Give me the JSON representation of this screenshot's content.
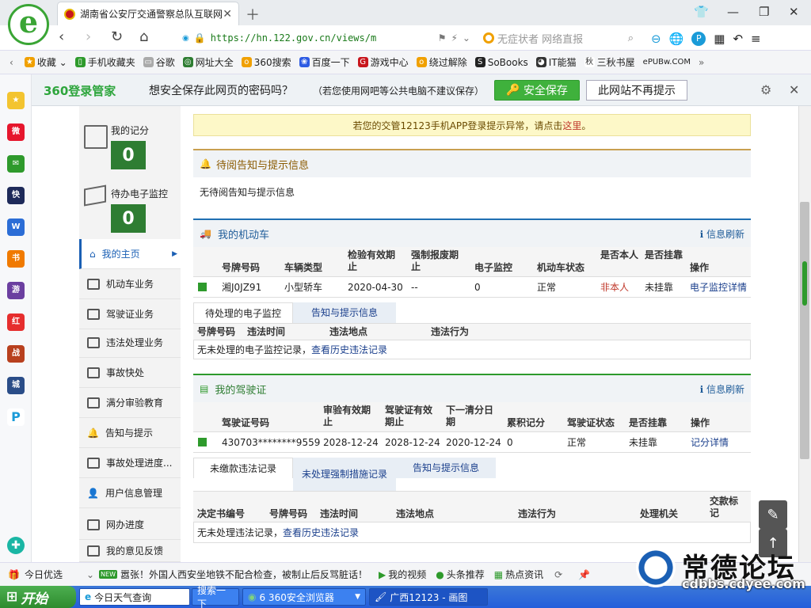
{
  "browser": {
    "tab_title": "湖南省公安厅交通警察总队互联网",
    "url": "https://hn.122.gov.cn/views/m",
    "search_placeholder": "无症状者 网络直报",
    "bookmarks": [
      "收藏",
      "手机收藏夹",
      "谷歌",
      "网址大全",
      "360搜索",
      "百度一下",
      "游戏中心",
      "绕过解除",
      "SoBooks",
      "IT能猫",
      "三秋书屋",
      "ePUBw.COM"
    ]
  },
  "password_bar": {
    "brand": "360登录管家",
    "question": "想安全保存此网页的密码吗？",
    "note": "（若您使用网吧等公共电脑不建议保存）",
    "save_label": "安全保存",
    "never_label": "此网站不再提示"
  },
  "sidebar_icons": [
    "favorites",
    "weibo",
    "mail",
    "tiantian",
    "word",
    "game1",
    "game2",
    "xiaohong",
    "game3",
    "game4",
    "p",
    "plus"
  ],
  "page_nav": {
    "score_label": "我的记分",
    "score_value": "0",
    "monitor_label": "待办电子监控",
    "monitor_value": "0",
    "items": [
      "我的主页",
      "机动车业务",
      "驾驶证业务",
      "违法处理业务",
      "事故快处",
      "满分审验教育",
      "告知与提示",
      "事故处理进度...",
      "用户信息管理",
      "网办进度",
      "我的意见反馈"
    ]
  },
  "notice": {
    "text": "若您的交管12123手机APP登录提示异常，请点击",
    "link": "这里",
    "tail": "。"
  },
  "pending_notice": {
    "title": "待阅告知与提示信息",
    "content": "无待阅告知与提示信息"
  },
  "vehicle": {
    "title": "我的机动车",
    "refresh": "信息刷新",
    "headers": [
      "号牌号码",
      "车辆类型",
      "检验有效期止",
      "强制报废期止",
      "电子监控",
      "机动车状态",
      "是否本人",
      "是否挂靠",
      "操作"
    ],
    "row": {
      "plate": "湘J0JZ91",
      "type": "小型轿车",
      "inspect": "2020-04-30",
      "scrap": "--",
      "monitor": "0",
      "status": "正常",
      "owner": "非本人",
      "affiliated": "未挂靠",
      "action": "电子监控详情"
    },
    "tabs": [
      "待处理的电子监控",
      "告知与提示信息"
    ],
    "sub_headers": [
      "号牌号码",
      "违法时间",
      "违法地点",
      "违法行为"
    ],
    "empty": "无未处理的电子监控记录，",
    "history_link": "查看历史违法记录"
  },
  "license": {
    "title": "我的驾驶证",
    "refresh": "信息刷新",
    "headers": [
      "驾驶证号码",
      "审验有效期止",
      "驾驶证有效期止",
      "下一清分日期",
      "累积记分",
      "驾驶证状态",
      "是否挂靠",
      "操作"
    ],
    "row": {
      "number": "430703********9559",
      "review": "2028-12-24",
      "valid": "2028-12-24",
      "clear": "2020-12-24",
      "points": "0",
      "status": "正常",
      "affiliated": "未挂靠",
      "action": "记分详情"
    },
    "tabs": [
      "未缴款违法记录",
      "未处理强制措施记录",
      "告知与提示信息"
    ],
    "sub_headers": [
      "决定书编号",
      "号牌号码",
      "违法时间",
      "违法地点",
      "违法行为",
      "处理机关",
      "交款标记"
    ],
    "empty": "无未处理违法记录，",
    "history_link": "查看历史违法记录"
  },
  "statusbar": {
    "today": "今日优选",
    "new_badge": "NEW",
    "news": "嚣张！外国人西安坐地铁不配合检查，被制止后反骂脏话！",
    "video": "我的视频",
    "headline": "头条推荐",
    "hot": "热点资讯"
  },
  "taskbar": {
    "start": "开始",
    "weather": "今日天气查询",
    "search": "搜索一下",
    "browser": "6 360安全浏览器",
    "paint": "广西12123 - 画图"
  },
  "watermark": {
    "text": "常德论坛",
    "url": "cdbbs.cdyee.com"
  },
  "colors": {
    "accent": "#1f6fb2",
    "green": "#2e9a2c",
    "warn": "#c0392b"
  }
}
